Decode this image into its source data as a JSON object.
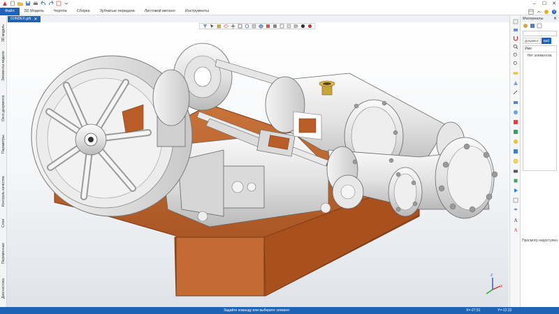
{
  "titlebar": {
    "title": "",
    "minimize": "–",
    "maximize": "☐",
    "close": "✕"
  },
  "ribbon": {
    "file": "Файл",
    "tabs": [
      "3D Модель",
      "Чертёж",
      "Сборка",
      "Зубчатые передачи",
      "Листовой металл",
      "Инструменты"
    ]
  },
  "doc": {
    "tab_label": "01INDEX.grb",
    "close": "✕"
  },
  "left_panel": {
    "items": [
      "3D модель",
      "Элементы модели",
      "Окно документа",
      "Параметры",
      "Контроль качества",
      "Слои",
      "Переменные",
      "Диагностика"
    ]
  },
  "materials": {
    "header": "Материалы",
    "pin": "✕",
    "tabs": [
      "Документ",
      "Биб"
    ],
    "column": "Имя",
    "empty": "Нет элементов.",
    "preview": "Просмотр недоступен"
  },
  "status": {
    "message": "Задайте команду или выберите элемент",
    "x": "X=-27.51",
    "y": "Y=-12.22"
  },
  "colors": {
    "accent": "#1f63b5",
    "wood": "#b85c28",
    "metal": "#dcdcdc"
  }
}
